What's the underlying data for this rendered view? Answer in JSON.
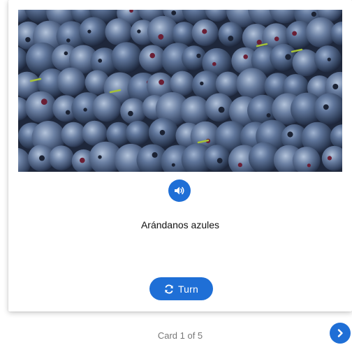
{
  "card": {
    "image_subject": "blueberries",
    "word": "Arándanos azules",
    "audio_icon": "speaker-icon",
    "turn_icon": "refresh-icon",
    "turn_label": "Turn"
  },
  "footer": {
    "counter": "Card 1 of 5",
    "next_icon": "chevron-right-icon"
  },
  "colors": {
    "accent": "#1f6fd6",
    "counter_text": "#777777"
  }
}
